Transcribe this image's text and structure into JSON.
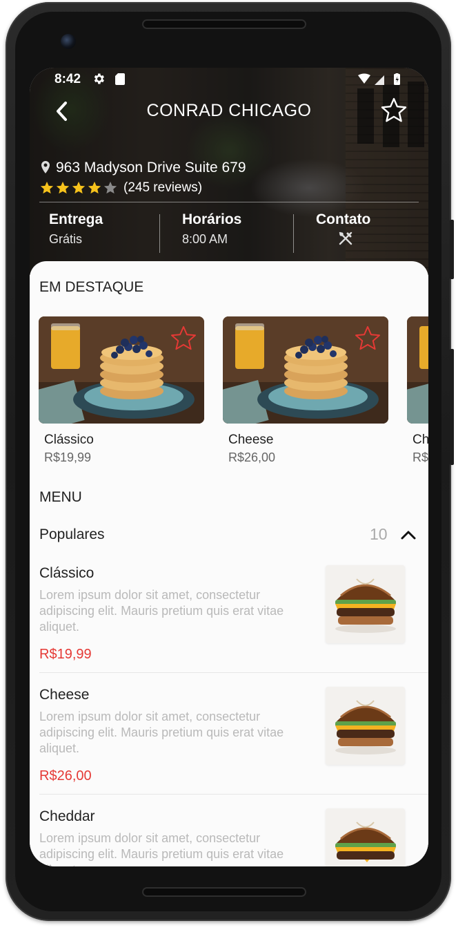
{
  "status": {
    "time": "8:42"
  },
  "header": {
    "title": "CONRAD CHICAGO",
    "address": "963 Madyson Drive Suite 679",
    "rating": 4,
    "rating_max": 5,
    "reviews_text": "(245 reviews)"
  },
  "info": {
    "delivery": {
      "title": "Entrega",
      "value": "Grátis"
    },
    "hours": {
      "title": "Horários",
      "value": "8:00 AM"
    },
    "contact": {
      "title": "Contato",
      "icon": "utensils-icon"
    }
  },
  "featured": {
    "section_title": "EM DESTAQUE",
    "items": [
      {
        "name": "Clássico",
        "price": "R$19,99"
      },
      {
        "name": "Cheese",
        "price": "R$26,00"
      },
      {
        "name": "Ch",
        "price": "R$"
      }
    ]
  },
  "menu": {
    "section_title": "MENU",
    "category": {
      "label": "Populares",
      "count": "10",
      "icon": "chevron-up-icon"
    },
    "items": [
      {
        "name": "Clássico",
        "description": "Lorem ipsum dolor sit amet, consectetur adipiscing elit. Mauris pretium quis erat vitae aliquet.",
        "price": "R$19,99"
      },
      {
        "name": "Cheese",
        "description": "Lorem ipsum dolor sit amet, consectetur adipiscing elit. Mauris pretium quis erat vitae aliquet.",
        "price": "R$26,00"
      },
      {
        "name": "Cheddar",
        "description": "Lorem ipsum dolor sit amet, consectetur adipiscing elit. Mauris pretium quis erat vitae aliquet.",
        "price": ""
      }
    ]
  },
  "colors": {
    "accent_price": "#e53935",
    "favorite_star_outline": "#e53935",
    "rating_star": "#f6c21c"
  }
}
